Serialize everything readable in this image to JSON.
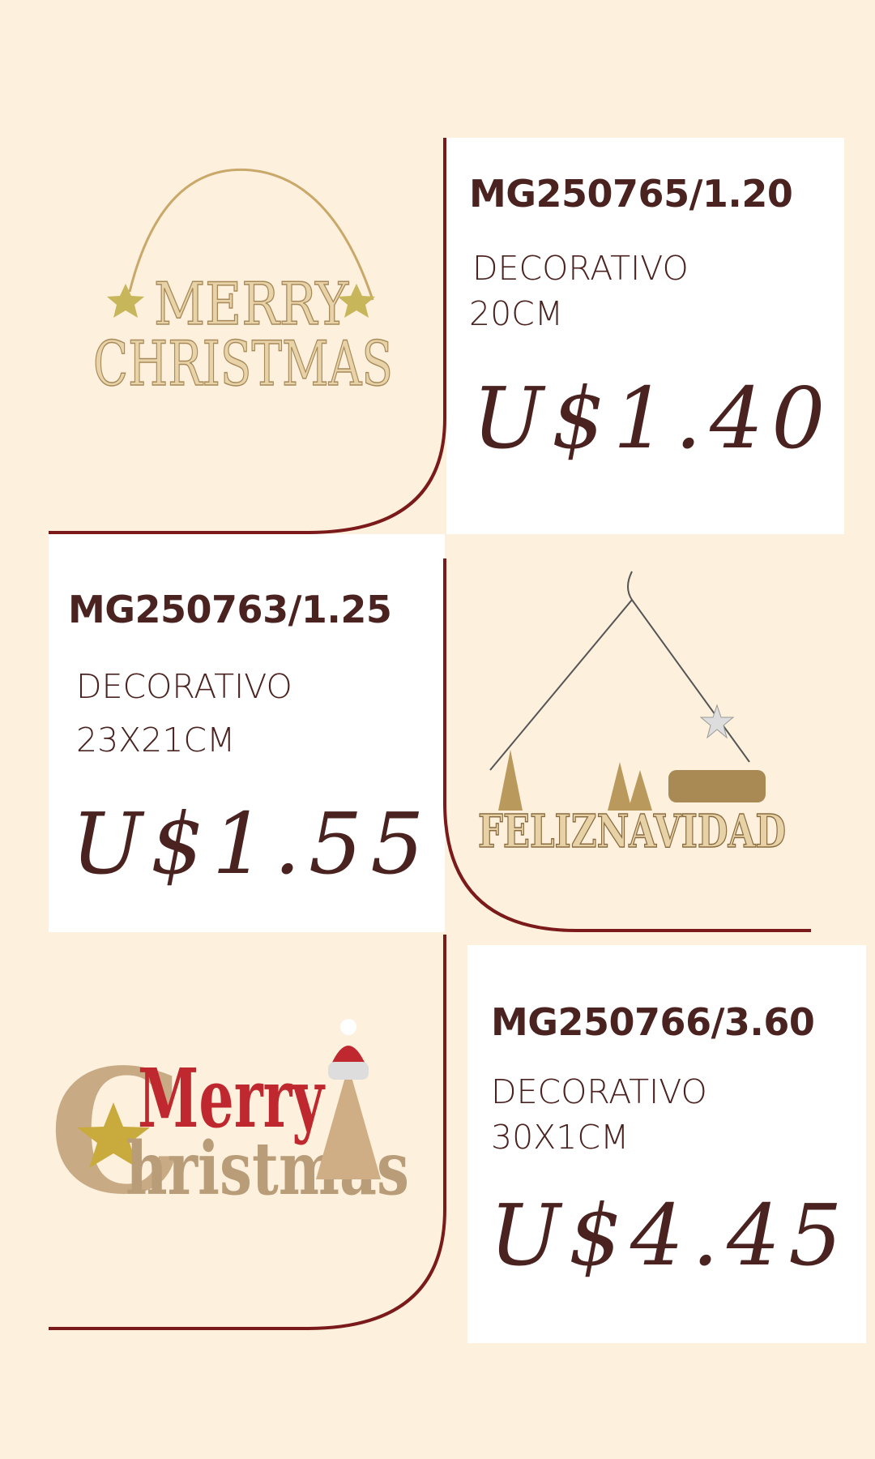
{
  "colors": {
    "background": "#fdf0dd",
    "card": "#ffffff",
    "text": "#4a2320",
    "accent_line": "#7a1a1a"
  },
  "products": [
    {
      "code": "MG250765/1.20",
      "desc_line1": "DECORATIVO",
      "desc_line2": "20CM",
      "price": "U$1.40",
      "image_text": "MERRY CHRISTMAS"
    },
    {
      "code": "MG250763/1.25",
      "desc_line1": "DECORATIVO",
      "desc_line2": "23X21CM",
      "price": "U$1.55",
      "image_text": "FELIZ NAVIDAD"
    },
    {
      "code": "MG250766/3.60",
      "desc_line1": "DECORATIVO",
      "desc_line2": "30X1CM",
      "price": "U$4.45",
      "image_text": "Merry Christmas"
    }
  ]
}
